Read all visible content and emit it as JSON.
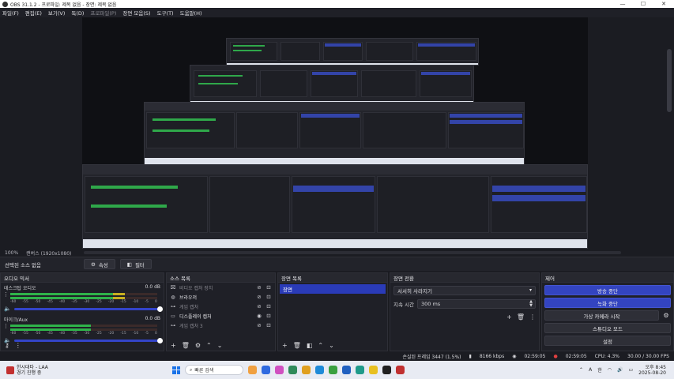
{
  "window": {
    "title": "OBS 31.1.2 - 프로파일: 제목 없음 - 장면: 제목 없음",
    "controls": [
      "—",
      "☐",
      "✕"
    ]
  },
  "menu": [
    "파일(F)",
    "편집(E)",
    "보기(V)",
    "독(D)",
    "프로파일(P)",
    "장면 모음(S)",
    "도구(T)",
    "도움말(H)"
  ],
  "preview": {
    "zoom": "100%",
    "canvas": "캔버스 (1920x1080)"
  },
  "scene_toolbar": {
    "label": "선택된 소스 없음",
    "properties": "속성",
    "filters": "필터"
  },
  "audio_mixer": {
    "title": "오디오 믹서",
    "scale": [
      "-60",
      "-55",
      "-50",
      "-45",
      "-40",
      "-35",
      "-30",
      "-25",
      "-20",
      "-15",
      "-10",
      "-5",
      "0"
    ],
    "channels": [
      {
        "name": "데스크탑 오디오",
        "db": "0.0 dB",
        "level": 0.78
      },
      {
        "name": "마이크/Aux",
        "db": "0.0 dB",
        "level": 0.55
      }
    ]
  },
  "sources": {
    "title": "소스 목록",
    "items": [
      {
        "icon": "display-icon",
        "glyph": "⌧",
        "name": "비디오 캡처 장치",
        "visible": "hidden",
        "dim": true
      },
      {
        "icon": "globe-icon",
        "glyph": "◍",
        "name": "브라우저",
        "visible": "hidden",
        "dim": false
      },
      {
        "icon": "gamepad-icon",
        "glyph": "⊶",
        "name": "게임 캡처",
        "visible": "hidden",
        "dim": true
      },
      {
        "icon": "monitor-icon",
        "glyph": "▭",
        "name": "디스플레이 캡처",
        "visible": "shown",
        "dim": false
      },
      {
        "icon": "gamepad-icon",
        "glyph": "⊶",
        "name": "게임 캡처 3",
        "visible": "hidden",
        "dim": true
      }
    ]
  },
  "scenes": {
    "title": "장면 목록",
    "items": [
      "장면"
    ]
  },
  "transitions": {
    "title": "장면 전환",
    "selected": "서서히 사라지기",
    "duration_label": "지속 시간",
    "duration_value": "300 ms"
  },
  "controls": {
    "title": "제어",
    "stop_stream": "방송 중단",
    "stop_record": "녹화 중단",
    "virtual_cam": "가상 카메라 시작",
    "studio_mode": "스튜디오 모드",
    "settings": "설정"
  },
  "status": {
    "dropped": "손실된 프레임 3447 (1.5%)",
    "bitrate": "8166 kbps",
    "stream_time": "02:59:05",
    "rec_time": "02:59:05",
    "cpu": "CPU: 4.3%",
    "fps": "30.00 / 30.00 FPS"
  },
  "taskbar": {
    "weather_line1": "한시대타 - LAA",
    "weather_line2": "경기 진행 중",
    "search_placeholder": "빠른 검색",
    "tray_lang": "A",
    "tray_ime": "한",
    "time": "오후 8:45",
    "date": "2025-08-20"
  },
  "colors": {
    "accent": "#3344c0",
    "meter_green": "#2fb34a",
    "meter_yellow": "#c8b020",
    "meter_red": "#c83030"
  }
}
